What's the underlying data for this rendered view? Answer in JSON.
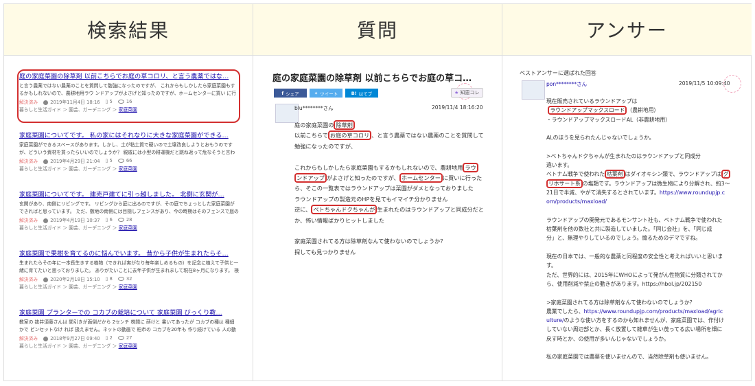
{
  "headers": {
    "search": "検索結果",
    "question": "質問",
    "answer": "アンサー"
  },
  "results": [
    {
      "title": "庭の家庭菜園の除草剤 以前こちらでお庭の草コロリ、と言う農薬ではな…",
      "snippet": "と言う農薬ではない農薬のことを質問して勉強になったのですが、 これからもしかしたら家庭菜園もするかもしれないので、農耕地用ラウ ンドアップがよさげと知ったのですが、ホームセンターに買い に行ったら、そこの一覧表ではラウ…",
      "status": "解決済み",
      "date": "2019年11月4日 18:16",
      "answers": "5",
      "views": "16",
      "category": "暮らしと生活ガイド ＞ 園芸、ガーデニング ＞",
      "tag": "家庭菜園"
    },
    {
      "title": "家庭菜園についてです。 私の家にはそれなりに大きな家庭菜園ができる…",
      "snippet": "家庭菜園ができるスペースがあります。しかし、土が粘土質で硬いので土壌改良しようとおもうのですが、どういう資材を買ったらいいのでしょうか？ 親戚には小型の耕運機だと跳ね返って危なそうと言われるぐらい硬いです。（使い方その…",
      "status": "解決済み",
      "date": "2019年4月29日 21:04",
      "answers": "5",
      "views": "66",
      "category": "暮らしと生活ガイド ＞ 園芸、ガーデニング ＞",
      "tag": "家庭菜園"
    },
    {
      "title": "家庭菜園についてです。 建売戸建てに引っ越しました。 北側に玄関が…",
      "snippet": "玄関があり、南側にリビングです。 リビングから庭に出るのですが、その庭でちょっとした家庭菜園ができればと思っています。 ただ、敷地の南側には目隠しフェンスがあり、今の時期はそのフェンスで庭の半分は日陰ができてしまいます…",
      "status": "解決済み",
      "date": "2019年4月19日 10:37",
      "answers": "6",
      "views": "28",
      "category": "暮らしと生活ガイド ＞ 園芸、ガーデニング ＞",
      "tag": "家庭菜園"
    },
    {
      "title": "家庭菜園で果樹を育てるのに悩んでいます。 昔から子供が生まれたらそ…",
      "snippet": "生まれたらその年に一本長生きする植物（できれば実がなり毎年楽しめるもの）を記念に植えて子供と一緒に育てたいと思っておりました。 ありがたいことに去年子供が生まれまして現在8ヶ月になります。 検討していたのは自家受粉でき…",
      "status": "解決済み",
      "date": "2020年2月18日 15:10",
      "answers": "8",
      "views": "32",
      "category": "暮らしと生活ガイド ＞ 園芸、ガーデニング ＞",
      "tag": "家庭菜園"
    },
    {
      "title": "家庭菜園 プランターでの コカブの栽培について 家庭菜園 びっくり教…",
      "snippet": "教室の 抜井須藤さんは 間引きが面倒だから 2センチ 株間に 蒔けと 書いてあったが コカブの種は 種細かで ピンセットなけ れば 扱えません。ネットの動画で 柏市の コカブを20年も 作り続けている 人の動画を見たら、帯状にまかれた もの…",
      "status": "解決済み",
      "date": "2018年9月27日 09:40",
      "answers": "2",
      "views": "27",
      "category": "暮らしと生活ガイド ＞ 園芸、ガーデニング ＞",
      "tag": "家庭菜園"
    }
  ],
  "question": {
    "title": "庭の家庭菜園の除草剤 以前こちらでお庭の草コ…",
    "share": {
      "facebook": "シェア",
      "twitter": "ツイート",
      "hatena": "はてブ",
      "chie": "知恵コレ"
    },
    "user": "blu********さん",
    "date": "2019/11/4  18:16:20",
    "body": {
      "p1a": "庭の家庭菜園の",
      "p1h": "除草剤",
      "p2a": "以前こちらで",
      "p2h": "お庭の草コロリ",
      "p2b": "、と言う農薬ではない農薬のことを質問して",
      "p3": "勉強になったのですが、",
      "p4a": "これからもしかしたら家庭菜園もするかもしれないので、農耕地用",
      "p4h": "ラウ",
      "p5h": "ンドアップ",
      "p5a": "がよさげと知ったのですが、",
      "p5h2": "ホームセンター",
      "p5b": "に買いに行った",
      "p6": "ら、そこの一覧表ではラウンドアップは菜園がダメとなっておりました",
      "p7": "ラウンドアップの製造元のHPを見てもイマイチ分かりません",
      "p8a": "逆に、",
      "p8h": "ベトちゃんドクちゃんが",
      "p8b": "生まれたのはラウンドアップと同成分だと",
      "p9": "か、怖い情報ばかりヒットしました",
      "p10": "家庭菜園されてる方は除草剤なんて使わないのでしょうか？",
      "p11": "探しても見つかりません"
    }
  },
  "answer": {
    "label": "ベストアンサーに選ばれた回答",
    "user": "pon********さん",
    "date": "2019/11/5  10:09:40",
    "body": {
      "a1": "現在販売されているラウンドアップは",
      "a2h": "ラウンドアップマックスロード",
      "a2": "（農耕地用）",
      "a3": "・ラウンドアップマックスロードAL（非農耕地用）",
      "a4": "ALのほうを見られたんじゃないでしょうか。",
      "a5": ">ベトちゃんドクちゃんが生まれたのはラウンドアップと同成分",
      "a6": "違います。",
      "a7a": "ベトナム戦争で使われた",
      "a7h": "枯葉剤",
      "a7b": "はダイオキシン類で、ラウンドアップは",
      "a7h2": "グ",
      "a8h": "リホサート系",
      "a8a": "の塩類です。ラウンドアップは微生物により分解され、約3〜",
      "a9a": "21日で半減、やがて消失するとされています。",
      "a9link": "https://www.roundupjp.c",
      "a10": "om/products/maxload/",
      "a11": "ラウンドアップの開発元であるモンサント社も、ベトナム戦争で使われた",
      "a12": "枯葉剤を他の数社と共に製造していました。「同じ会社」を、「同じ成",
      "a13": "分」と、無理やりしているのでしょう。煽るためのデマですね。",
      "a14": "現在の日本では、一般的な農薬と同程度の安全性と考えればいいと思いま",
      "a15": "す。",
      "a16": "ただ、世界的には、2015年にWHOによって発がん性物質に分類されてか",
      "a17": "ら、使用削減や禁止の動きがあります。https://hbol.jp/202150",
      "a18": ">家庭菜園されてる方は除草剤なんて使わないのでしょうか？",
      "a19a": "農業でしたら、",
      "a19link": "https://www.roundupjp.com/products/maxload/agric",
      "a20link": "ulture/",
      "a20": "のような使い方をするのかも知れませんが、家庭菜園では、作付け",
      "a21": "していない周辺部とか、長く放置して雑草が生い茂ってる広い場所を畑に",
      "a22": "戻す時とか、の使用が多いんじゃないでしょうか。",
      "a23": "私の家庭菜園では農薬を使いませんので、当然除草剤も使いません。"
    }
  }
}
